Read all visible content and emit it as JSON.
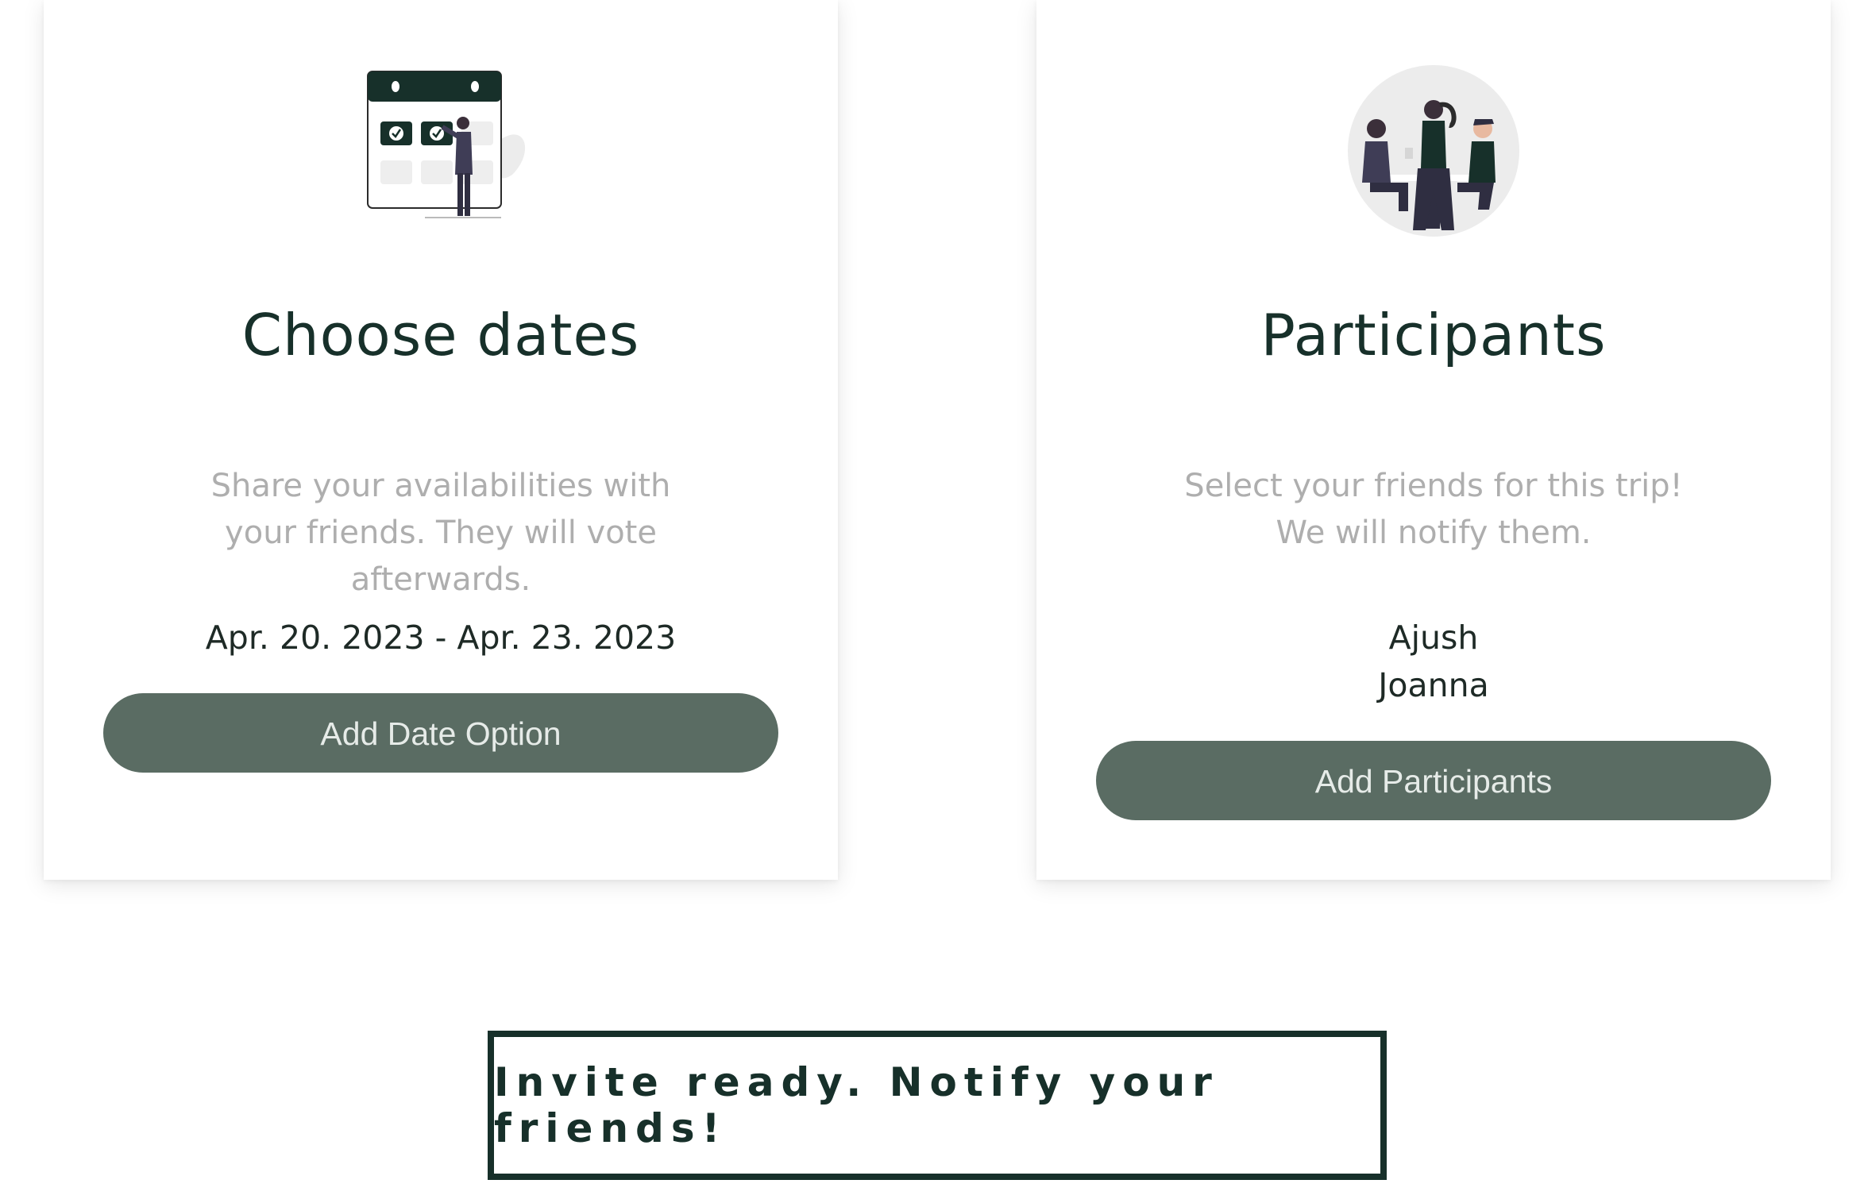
{
  "dates_card": {
    "title": "Choose dates",
    "description": "Share your availabilities with your friends. They will vote afterwards.",
    "date_range": "Apr. 20. 2023 - Apr. 23. 2023",
    "button_label": "Add Date Option"
  },
  "participants_card": {
    "title": "Participants",
    "description": "Select your friends for this trip! We will notify them.",
    "participants": [
      "Ajush",
      "Joanna"
    ],
    "button_label": "Add Participants"
  },
  "notify_banner": {
    "text": "Invite ready. Notify your friends!"
  },
  "colors": {
    "primary_dark": "#17302a",
    "button_bg": "#5a6c63",
    "muted_text": "#aeaeae"
  },
  "icons": {
    "dates_illustration": "calendar-illustration-icon",
    "participants_illustration": "people-meeting-illustration-icon"
  }
}
